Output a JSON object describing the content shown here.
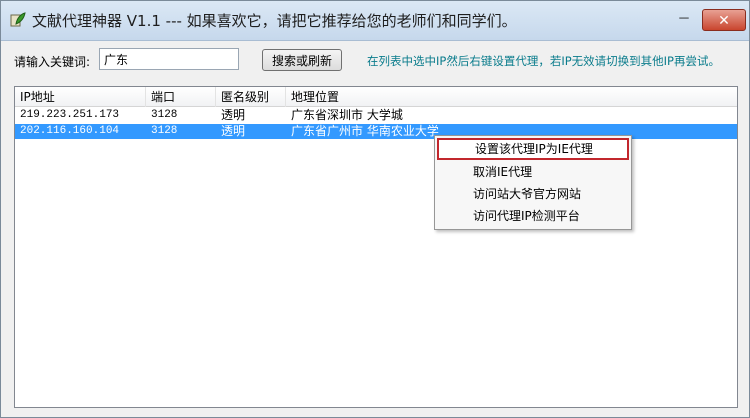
{
  "window": {
    "title": "文献代理神器 V1.1 ---  如果喜欢它，请把它推荐给您的老师们和同学们。",
    "minimize_label": "－",
    "close_label": "✕"
  },
  "search": {
    "label": "请输入关键词:",
    "value": "广东",
    "button_label": "搜索或刷新",
    "hint": "在列表中选中IP然后右键设置代理，若IP无效请切换到其他IP再尝试。"
  },
  "table": {
    "columns": [
      "IP地址",
      "端口",
      "匿名级别",
      "地理位置"
    ],
    "rows": [
      {
        "ip": "219.223.251.173",
        "port": "3128",
        "anonymity": "透明",
        "location": "广东省深圳市 大学城",
        "selected": false
      },
      {
        "ip": "202.116.160.104",
        "port": "3128",
        "anonymity": "透明",
        "location": "广东省广州市 华南农业大学",
        "selected": true
      }
    ]
  },
  "context_menu": {
    "items": [
      {
        "label": "设置该代理IP为IE代理",
        "highlighted": true
      },
      {
        "label": "取消IE代理",
        "highlighted": false
      },
      {
        "label": "访问站大爷官方网站",
        "highlighted": false
      },
      {
        "label": "访问代理IP检测平台",
        "highlighted": false
      }
    ]
  },
  "colors": {
    "selection": "#3399ff",
    "hint_text": "#0a7c8c",
    "highlight_border": "#c2272d"
  },
  "icons": {
    "app": "app-leaf-icon"
  }
}
